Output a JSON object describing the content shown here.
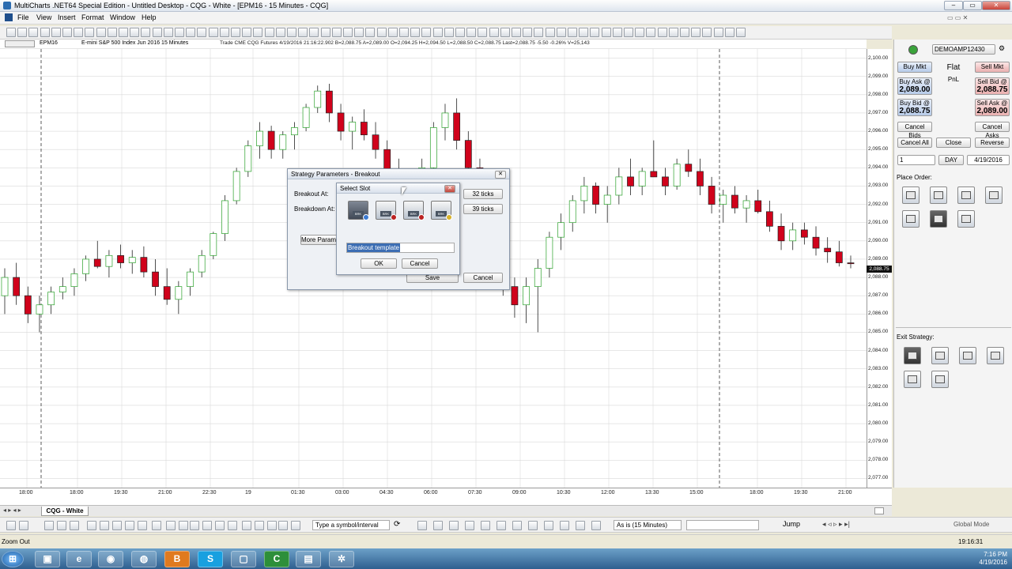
{
  "window": {
    "title": "MultiCharts .NET64 Special Edition - Untitled Desktop - CQG - White - [EPM16 - 15 Minutes - CQG]"
  },
  "menu": [
    "File",
    "View",
    "Insert",
    "Format",
    "Window",
    "Help"
  ],
  "info": {
    "symbol": "EPM16",
    "description": "E-mini S&P 500 Index Jun 2016  15 Minutes",
    "quote": "Trade  CME  CQG  Futures  4/19/2016  21:16:22.902  B=2,088.75  A=2,089.00  O=2,094.25  H=2,094.50  L=2,088.50  C=2,088.75  Last=2,088.75  -5.50  -0.26%  V=25,143"
  },
  "price_axis": [
    "2,100.00",
    "2,099.00",
    "2,098.00",
    "2,097.00",
    "2,096.00",
    "2,095.00",
    "2,094.00",
    "2,093.00",
    "2,092.00",
    "2,091.00",
    "2,090.00",
    "2,089.00",
    "2,088.00",
    "2,087.00",
    "2,086.00",
    "2,085.00",
    "2,084.00",
    "2,083.00",
    "2,082.00",
    "2,081.00",
    "2,080.00",
    "2,079.00",
    "2,078.00",
    "2,077.00"
  ],
  "time_axis": [
    "18:00",
    "18:00",
    "19:30",
    "21:00",
    "22:30",
    "19",
    "01:30",
    "03:00",
    "04:30",
    "06:00",
    "07:30",
    "09:00",
    "10:30",
    "12:00",
    "13:30",
    "15:00",
    "18:00",
    "19:30",
    "21:00"
  ],
  "last_price_tag": "2,088.75",
  "chart_data": {
    "type": "candlestick",
    "symbol": "EPM16",
    "interval": "15 Minutes",
    "ylim": [
      2076.5,
      2100.5
    ],
    "candles": [
      [
        2087.0,
        2088.5,
        2086.0,
        2088.0
      ],
      [
        2088.0,
        2088.8,
        2086.5,
        2087.0
      ],
      [
        2087.0,
        2087.5,
        2085.5,
        2086.0
      ],
      [
        2086.0,
        2087.0,
        2085.0,
        2086.5
      ],
      [
        2086.5,
        2087.5,
        2086.0,
        2087.2
      ],
      [
        2087.2,
        2088.0,
        2086.8,
        2087.5
      ],
      [
        2087.5,
        2088.5,
        2087.0,
        2088.2
      ],
      [
        2088.2,
        2089.2,
        2087.8,
        2089.0
      ],
      [
        2089.0,
        2090.0,
        2088.5,
        2088.6
      ],
      [
        2088.6,
        2089.5,
        2088.0,
        2089.2
      ],
      [
        2089.2,
        2089.8,
        2088.5,
        2088.8
      ],
      [
        2088.8,
        2089.5,
        2088.2,
        2089.1
      ],
      [
        2089.1,
        2089.7,
        2088.0,
        2088.3
      ],
      [
        2088.3,
        2089.0,
        2087.0,
        2087.5
      ],
      [
        2087.5,
        2088.5,
        2086.5,
        2086.8
      ],
      [
        2086.8,
        2087.8,
        2086.0,
        2087.5
      ],
      [
        2087.5,
        2088.5,
        2087.0,
        2088.3
      ],
      [
        2088.3,
        2089.5,
        2088.0,
        2089.2
      ],
      [
        2089.2,
        2090.5,
        2089.0,
        2090.4
      ],
      [
        2090.4,
        2092.5,
        2090.0,
        2092.2
      ],
      [
        2092.2,
        2094.0,
        2092.0,
        2093.8
      ],
      [
        2093.8,
        2095.5,
        2093.5,
        2095.2
      ],
      [
        2095.2,
        2096.5,
        2094.5,
        2096.0
      ],
      [
        2096.0,
        2096.3,
        2094.5,
        2095.0
      ],
      [
        2095.0,
        2096.0,
        2094.5,
        2095.8
      ],
      [
        2095.8,
        2096.5,
        2095.0,
        2096.2
      ],
      [
        2096.2,
        2097.5,
        2096.0,
        2097.3
      ],
      [
        2097.3,
        2098.5,
        2097.0,
        2098.2
      ],
      [
        2098.2,
        2098.6,
        2096.5,
        2097.0
      ],
      [
        2097.0,
        2097.5,
        2095.5,
        2096.0
      ],
      [
        2096.0,
        2096.8,
        2095.0,
        2096.5
      ],
      [
        2096.5,
        2097.2,
        2095.5,
        2095.8
      ],
      [
        2095.8,
        2096.5,
        2094.5,
        2095.0
      ],
      [
        2095.0,
        2095.5,
        2093.0,
        2093.5
      ],
      [
        2093.5,
        2094.5,
        2092.0,
        2092.5
      ],
      [
        2092.5,
        2093.5,
        2091.0,
        2091.5
      ],
      [
        2091.5,
        2094.5,
        2091.0,
        2094.0
      ],
      [
        2094.0,
        2096.5,
        2093.5,
        2096.2
      ],
      [
        2096.2,
        2097.5,
        2095.5,
        2097.0
      ],
      [
        2097.0,
        2097.8,
        2095.0,
        2095.5
      ],
      [
        2095.5,
        2096.0,
        2093.5,
        2094.0
      ],
      [
        2094.0,
        2094.5,
        2092.5,
        2093.0
      ],
      [
        2093.0,
        2093.5,
        2089.5,
        2090.0
      ],
      [
        2090.0,
        2090.5,
        2087.0,
        2087.5
      ],
      [
        2087.5,
        2088.0,
        2085.8,
        2086.5
      ],
      [
        2086.5,
        2088.0,
        2085.5,
        2087.5
      ],
      [
        2087.5,
        2089.0,
        2085.0,
        2088.5
      ],
      [
        2088.5,
        2090.5,
        2088.0,
        2090.2
      ],
      [
        2090.2,
        2091.5,
        2089.5,
        2091.0
      ],
      [
        2091.0,
        2092.5,
        2090.5,
        2092.2
      ],
      [
        2092.2,
        2093.5,
        2091.5,
        2093.0
      ],
      [
        2093.0,
        2093.2,
        2091.5,
        2092.0
      ],
      [
        2092.0,
        2093.0,
        2091.0,
        2092.5
      ],
      [
        2092.5,
        2094.0,
        2092.0,
        2093.5
      ],
      [
        2093.5,
        2094.5,
        2092.5,
        2093.0
      ],
      [
        2093.0,
        2094.0,
        2092.5,
        2093.8
      ],
      [
        2093.8,
        2095.5,
        2093.5,
        2093.5
      ],
      [
        2093.5,
        2094.0,
        2092.5,
        2093.0
      ],
      [
        2093.0,
        2094.5,
        2092.8,
        2094.2
      ],
      [
        2094.2,
        2095.0,
        2093.5,
        2093.8
      ],
      [
        2093.8,
        2094.5,
        2092.5,
        2093.0
      ],
      [
        2093.0,
        2093.5,
        2091.5,
        2092.0
      ],
      [
        2092.0,
        2092.8,
        2091.0,
        2092.5
      ],
      [
        2092.5,
        2093.0,
        2091.5,
        2091.8
      ],
      [
        2091.8,
        2092.5,
        2091.0,
        2092.2
      ],
      [
        2092.2,
        2092.8,
        2091.5,
        2091.6
      ],
      [
        2091.6,
        2092.2,
        2090.5,
        2090.8
      ],
      [
        2090.8,
        2091.5,
        2089.5,
        2090.0
      ],
      [
        2090.0,
        2091.0,
        2089.5,
        2090.6
      ],
      [
        2090.6,
        2091.0,
        2089.8,
        2090.2
      ],
      [
        2090.2,
        2090.8,
        2089.2,
        2089.6
      ],
      [
        2089.6,
        2090.2,
        2088.8,
        2089.4
      ],
      [
        2089.4,
        2090.0,
        2088.6,
        2088.8
      ],
      [
        2088.8,
        2089.2,
        2088.5,
        2088.75
      ]
    ]
  },
  "dom": {
    "account": "DEMOAMP12430",
    "buy_mkt": "Buy Mkt",
    "sell_mkt": "Sell Mkt",
    "position": "Flat",
    "pnl": "PnL",
    "buy_ask": {
      "label": "Buy Ask @",
      "price": "2,089.00"
    },
    "sell_bid": {
      "label": "Sell Bid @",
      "price": "2,088.75"
    },
    "buy_bid": {
      "label": "Buy Bid @",
      "price": "2,088.75"
    },
    "sell_ask": {
      "label": "Sell Ask @",
      "price": "2,089.00"
    },
    "cancel_bids": "Cancel Bids",
    "cancel_asks": "Cancel Asks",
    "cancel_all": "Cancel All",
    "close": "Close",
    "reverse": "Reverse",
    "qty": "1",
    "tif": "DAY",
    "date": "4/19/2016",
    "place_order": "Place Order:",
    "exit_strategy": "Exit Strategy:"
  },
  "strategy_dialog": {
    "title": "Strategy Parameters - Breakout",
    "breakout_label": "Breakout At:",
    "breakdown_label": "Breakdown At:",
    "breakout_value": "32 ticks",
    "breakdown_value": "39 ticks",
    "more": "More Parame",
    "save": "Save",
    "cancel": "Cancel"
  },
  "slot_dialog": {
    "title": "Select Slot",
    "slots": [
      "BRK",
      "BRK",
      "BRK",
      "BRK"
    ],
    "template_name": "Breakout template",
    "ok": "OK",
    "cancel": "Cancel"
  },
  "tabs": {
    "chart_tab": "CQG - White"
  },
  "bottom_toolbar": {
    "symbol_input": "Type a symbol/interval",
    "resolution": "As is (15 Minutes)",
    "jump": "Jump",
    "global_mode": "Global Mode"
  },
  "status": {
    "left": "Zoom Out",
    "time": "19:16:31"
  },
  "clock": {
    "time": "7:16 PM",
    "date": "4/19/2016"
  },
  "colors": {
    "bull": "#2aa12a",
    "bear": "#d0021b",
    "grid": "#d9d9d9",
    "accent": "#3b6db3"
  }
}
